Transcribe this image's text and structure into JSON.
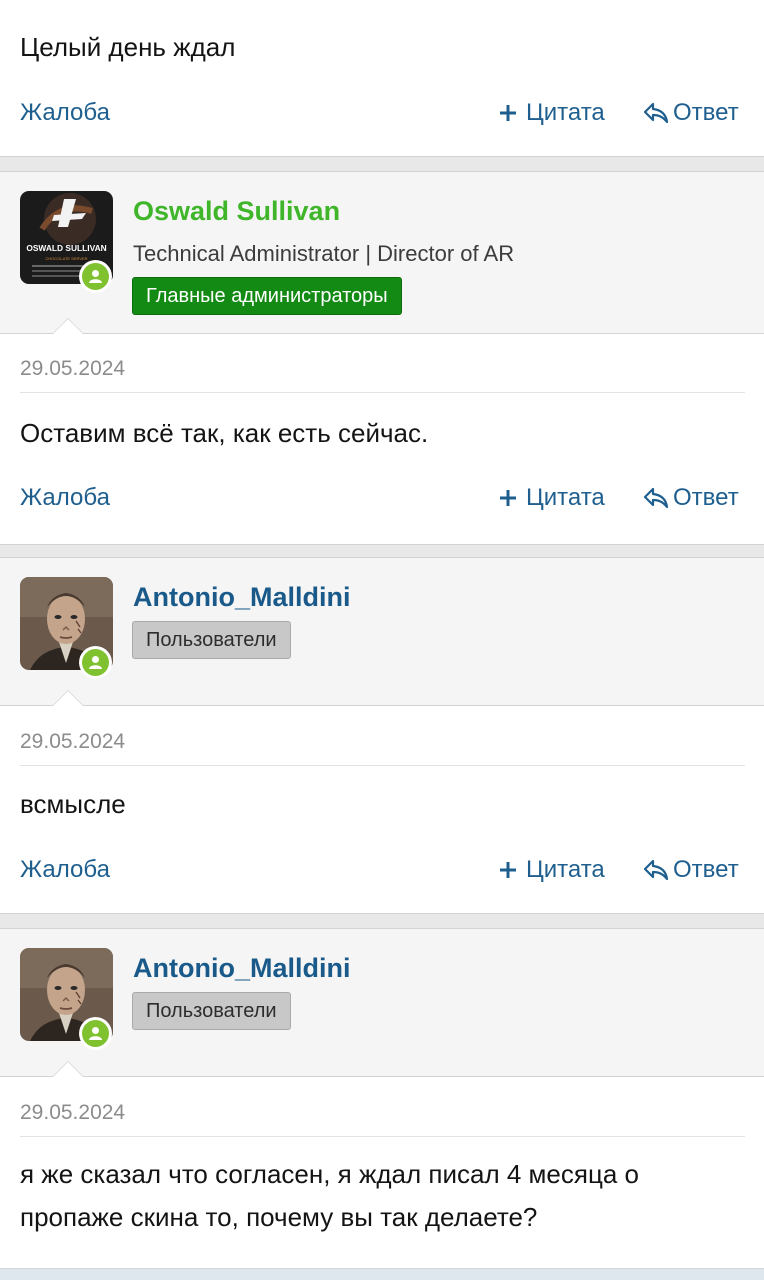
{
  "first_post": {
    "message": "Целый день ждал",
    "report_label": "Жалоба",
    "quote_label": "Цитата",
    "reply_label": "Ответ"
  },
  "posts": [
    {
      "username": "Oswald Sullivan",
      "user_title": "Technical Administrator | Director of AR",
      "group_badge": "Главные администраторы",
      "avatar_text": "OSWALD SULLIVAN",
      "avatar_subtext": "CHOCOLATE SERVER",
      "date": "29.05.2024",
      "message": "Оставим всё так, как есть сейчас.",
      "report_label": "Жалоба",
      "quote_label": "Цитата",
      "reply_label": "Ответ"
    },
    {
      "username": "Antonio_Malldini",
      "group_badge": "Пользователи",
      "date": "29.05.2024",
      "message": "всмысле",
      "report_label": "Жалоба",
      "quote_label": "Цитата",
      "reply_label": "Ответ"
    },
    {
      "username": "Antonio_Malldini",
      "group_badge": "Пользователи",
      "date": "29.05.2024",
      "message": "я же сказал что согласен, я ждал писал 4 месяца о пропаже скина то, почему вы так делаете?"
    }
  ],
  "colors": {
    "admin_name": "#3fb62a",
    "user_name": "#1a5a8a",
    "admin_badge": "#138a13",
    "user_badge": "#c8c8c8",
    "link": "#1f5f8f",
    "online": "#7fc12f"
  }
}
